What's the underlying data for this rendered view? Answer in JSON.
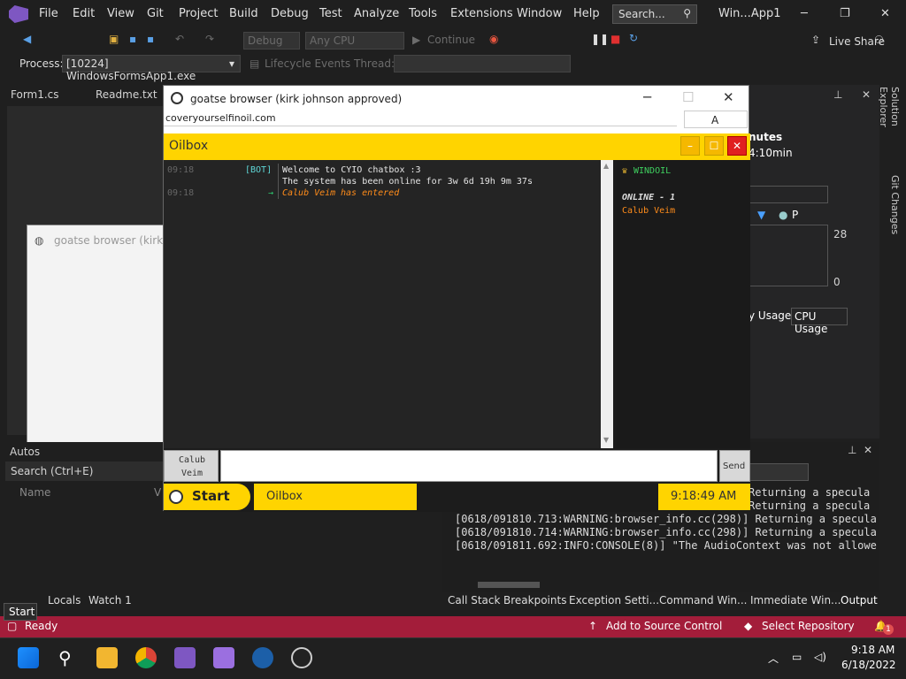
{
  "menu": [
    "File",
    "Edit",
    "View",
    "Git",
    "Project",
    "Build",
    "Debug",
    "Test",
    "Analyze",
    "Tools",
    "Extensions",
    "Window",
    "Help"
  ],
  "search_label": "Search...",
  "window_title": "Win...App1",
  "toolbar": {
    "config": "Debug",
    "platform": "Any CPU",
    "continue": "Continue",
    "live_share": "Live Share",
    "process_label": "Process:",
    "process_value": "[10224] WindowsFormsApp1.exe",
    "lifecycle": "Lifecycle Events",
    "thread": "Thread:"
  },
  "doc_tabs": [
    "Form1.cs",
    "Readme.txt"
  ],
  "form_preview_title": "goatse browser (kirk johnson",
  "autos": {
    "title": "Autos",
    "search": "Search (Ctrl+E)",
    "col_name": "Name",
    "col_value": "V"
  },
  "right_panel": {
    "minutes": "nutes",
    "elapsed": "4:10min",
    "val_top": "28",
    "val_bottom": "0",
    "memory_tab": "y Usage",
    "cpu_tab": "CPU Usage",
    "p_label": "P"
  },
  "sidebar": {
    "solution_explorer": "Solution Explorer",
    "git_changes": "Git Changes"
  },
  "output_lines": [
    "[0618/091810.713:WARNING:browser_info.cc(298)] Returning a specula",
    "[0618/091810.714:WARNING:browser_info.cc(298)] Returning a specula",
    "[0618/091811.692:INFO:CONSOLE(8)] \"The AudioContext was not allowe"
  ],
  "output_partial": [
    "Returning a specula",
    "Returning a specula"
  ],
  "bottom_tabs_left": [
    "Locals",
    "Watch 1"
  ],
  "bottom_tabs_right": [
    "Call Stack",
    "Breakpoints",
    "Exception Setti...",
    "Command Win...",
    "Immediate Win...",
    "Output"
  ],
  "tooltip": "Start",
  "status": {
    "ready": "Ready",
    "source_control": "Add to Source Control",
    "repository": "Select Repository",
    "notifications": "1"
  },
  "taskbar": {
    "time": "9:18 AM",
    "date": "6/18/2022"
  },
  "browser": {
    "title": "goatse browser (kirk johnson approved)",
    "url": "coveryourselfinoil.com",
    "a_button": "A"
  },
  "oilbox": {
    "title": "Oilbox",
    "chat": {
      "l1_time": "09:18",
      "l1_sender": "[BOT]",
      "l1_msg": "Welcome to CYIO chatbox :3",
      "l2_msg": "The system has been online for 3w 6d 19h 9m 37s",
      "l3_time": "09:18",
      "l3_arrow": "→",
      "l3_user": "Calub Veim",
      "l3_suffix": "has entered"
    },
    "users": {
      "channel": "WINDOIL",
      "online": "ONLINE - 1",
      "user1": "Calub Veim"
    },
    "name_line1": "Calub",
    "name_line2": "Veim",
    "send": "Send",
    "start": "Start",
    "task": "Oilbox",
    "clock": "9:18:49 AM"
  },
  "colors": {
    "vs_purple": "#7e57c2",
    "status_red": "#a31d3a",
    "oil_yellow": "#ffd400",
    "close_red": "#e02020"
  }
}
